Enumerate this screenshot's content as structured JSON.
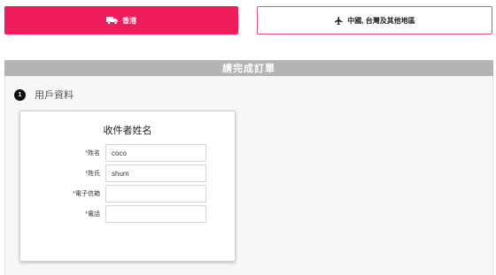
{
  "shipping": {
    "hk_label": "香港",
    "intl_label": "中國, 台灣及其他地區",
    "hk_icon": "truck-icon",
    "intl_icon": "airplane-icon",
    "active_color": "#ef1d5c",
    "border_color": "#e0507a"
  },
  "order": {
    "header_title": "請完成訂單",
    "step_number": "1",
    "step_title": "用戶資料"
  },
  "recipient": {
    "title": "收件者姓名",
    "required_mark": "*",
    "fields": [
      {
        "label": "姓名",
        "value": "coco"
      },
      {
        "label": "姓氏",
        "value": "shum"
      },
      {
        "label": "電子信箱",
        "value": ""
      },
      {
        "label": "電話",
        "value": ""
      }
    ]
  }
}
